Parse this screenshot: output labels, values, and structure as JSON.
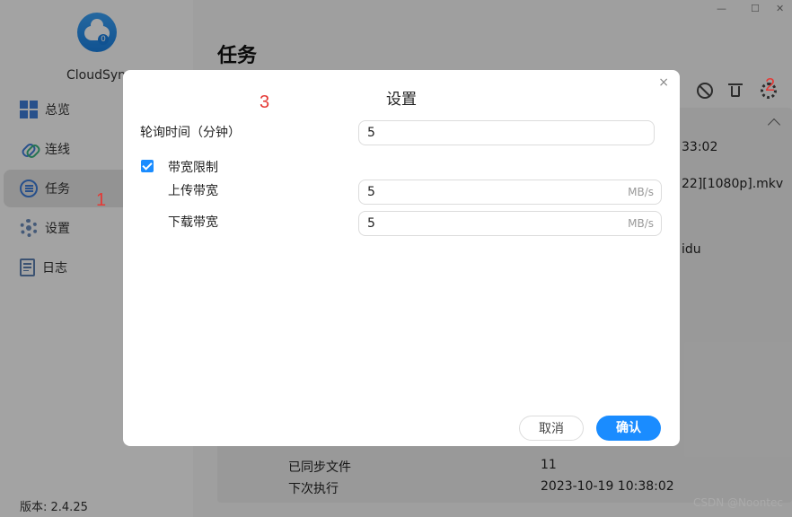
{
  "app": {
    "name": "CloudSync",
    "version_label": "版本: 2.4.25"
  },
  "window_controls": {
    "minimize": "—",
    "maximize": "☐",
    "close": "✕"
  },
  "sidebar": {
    "items": [
      {
        "label": "总览",
        "icon": "overview-icon"
      },
      {
        "label": "连线",
        "icon": "link-icon"
      },
      {
        "label": "任务",
        "icon": "task-icon",
        "active": true
      },
      {
        "label": "设置",
        "icon": "gear-icon"
      },
      {
        "label": "日志",
        "icon": "log-icon"
      }
    ]
  },
  "main": {
    "title": "任务",
    "background_fragments": {
      "time_fragment": "33:02",
      "file_fragment": "22][1080p].mkv",
      "text_fragment": "idu"
    },
    "details": [
      {
        "label": "已同步文件",
        "value": "11"
      },
      {
        "label": "下次执行",
        "value": "2023-10-19 10:38:02"
      }
    ]
  },
  "annotations": {
    "a1": "1",
    "a2": "2",
    "a3": "3"
  },
  "dialog": {
    "title": "设置",
    "close": "×",
    "poll_label": "轮询时间（分钟）",
    "poll_value": "5",
    "bandwidth_label": "带宽限制",
    "bandwidth_checked": true,
    "upload_label": "上传带宽",
    "upload_value": "5",
    "upload_unit": "MB/s",
    "download_label": "下载带宽",
    "download_value": "5",
    "download_unit": "MB/s",
    "cancel_label": "取消",
    "ok_label": "确认"
  },
  "watermark": "CSDN @Noontec",
  "colors": {
    "accent": "#1a8cff",
    "annotation": "#e53935"
  }
}
